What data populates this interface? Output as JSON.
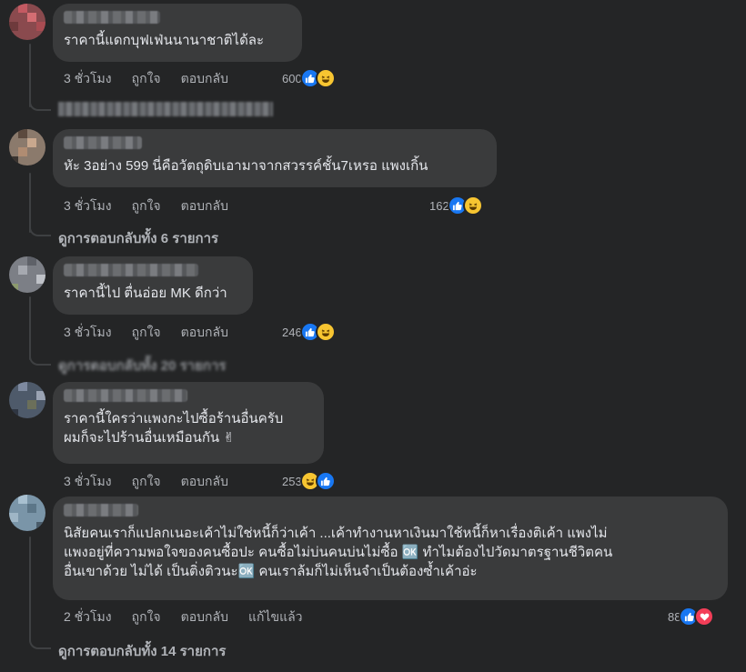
{
  "colors": {
    "background": "#242526",
    "bubble": "#3a3b3c",
    "text": "#e4e6eb",
    "meta": "#b0b3b8",
    "like": "#1877f2",
    "haha": "#f7c531",
    "love": "#f33e58"
  },
  "comments": [
    {
      "text": "ราคานี้แดกบุฟเฟ่นนานาชาติได้ละ",
      "time": "3 ชั่วโมง",
      "like_label": "ถูกใจ",
      "reply_label": "ตอบกลับ",
      "reaction_count": "600",
      "reactions": [
        "like-icon",
        "haha-icon"
      ],
      "view_replies": "ดูการตอบกลับทั้ง 22 รายการ"
    },
    {
      "text": "หัะ 3อย่าง 599 นี่คือวัตถุดิบเอามาจากสวรรค์ชั้น7เหรอ แพงเกิ้น",
      "time": "3 ชั่วโมง",
      "like_label": "ถูกใจ",
      "reply_label": "ตอบกลับ",
      "reaction_count": "162",
      "reactions": [
        "like-icon",
        "haha-icon"
      ],
      "view_replies": "ดูการตอบกลับทั้ง 6 รายการ"
    },
    {
      "text": "ราคานี้ไป ตื่นอ่อย MK ดีกว่า",
      "time": "3 ชั่วโมง",
      "like_label": "ถูกใจ",
      "reply_label": "ตอบกลับ",
      "reaction_count": "246",
      "reactions": [
        "like-icon",
        "haha-icon"
      ],
      "view_replies": "ดูการตอบกลับทั้ง 20 รายการ"
    },
    {
      "text": "ราคานี้ใครว่าแพงกะไปซื้อร้านอื่นครับ\nผมก็จะไปร้านอื่นเหมือนกัน ✌",
      "time": "3 ชั่วโมง",
      "like_label": "ถูกใจ",
      "reply_label": "ตอบกลับ",
      "reaction_count": "253",
      "reactions": [
        "haha-icon",
        "like-icon"
      ]
    },
    {
      "text": "นิสัยคนเราก็แปลกเนอะเค้าไม่ใช่หนี้ก็ว่าเค้า ...เค้าทำงานหาเงินมาใช้หนี้ก็หาเรื่องติเค้า แพงไม่\nแพงอยู่ที่ความพอใจของคนซื้อปะ คนซื้อไม่บ่นคนบ่นไม่ซื้อ 🆗 ทำไมต้องไปวัดมาตรฐานชีวิตคน\nอื่นเขาด้วย ไม่ได้ เป็นติ่งติวนะ🆗 คนเราล้มก็ไม่เห็นจำเป็นต้องซ้ำเค้าอ่ะ",
      "time": "2 ชั่วโมง",
      "like_label": "ถูกใจ",
      "reply_label": "ตอบกลับ",
      "edited_label": "แก้ไขแล้ว",
      "reaction_count": "88",
      "reactions": [
        "like-icon",
        "love-icon"
      ],
      "view_replies": "ดูการตอบกลับทั้ง 14 รายการ"
    }
  ]
}
